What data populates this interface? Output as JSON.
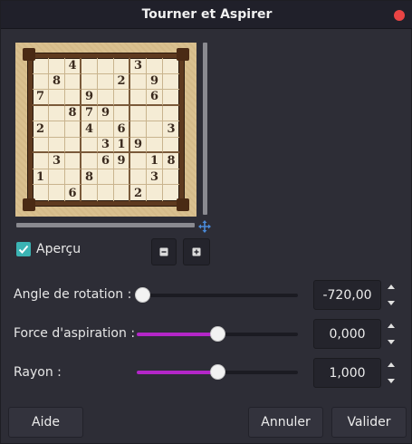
{
  "window": {
    "title": "Tourner et Aspirer"
  },
  "preview": {
    "checkbox_label": "Aperçu",
    "checked": true,
    "sudoku": [
      [
        "",
        "",
        "4",
        "",
        "",
        "",
        "3",
        "",
        ""
      ],
      [
        "",
        "8",
        "",
        "",
        "",
        "2",
        "",
        "9",
        ""
      ],
      [
        "7",
        "",
        "",
        "9",
        "",
        "",
        "",
        "6",
        ""
      ],
      [
        "",
        "",
        "8",
        "7",
        "9",
        "",
        "",
        "",
        ""
      ],
      [
        "2",
        "",
        "",
        "4",
        "",
        "6",
        "",
        "",
        "3"
      ],
      [
        "",
        "",
        "",
        "",
        "3",
        "1",
        "9",
        "",
        ""
      ],
      [
        "",
        "3",
        "",
        "",
        "6",
        "9",
        "",
        "1",
        "8"
      ],
      [
        "1",
        "",
        "",
        "8",
        "",
        "",
        "",
        "3",
        ""
      ],
      [
        "",
        "",
        "6",
        "",
        "",
        "",
        "2",
        "",
        ""
      ]
    ]
  },
  "params": [
    {
      "label": "Angle de rotation :",
      "value": "-720,00",
      "fraction": 0.0,
      "colored": false
    },
    {
      "label": "Force d'aspiration :",
      "value": "0,000",
      "fraction": 0.5,
      "colored": true
    },
    {
      "label": "Rayon :",
      "value": "1,000",
      "fraction": 0.5,
      "colored": true
    }
  ],
  "buttons": {
    "help": "Aide",
    "cancel": "Annuler",
    "ok": "Valider"
  },
  "colors": {
    "accent": "#b326c8",
    "check": "#3bb3b3",
    "close": "#e94444"
  }
}
